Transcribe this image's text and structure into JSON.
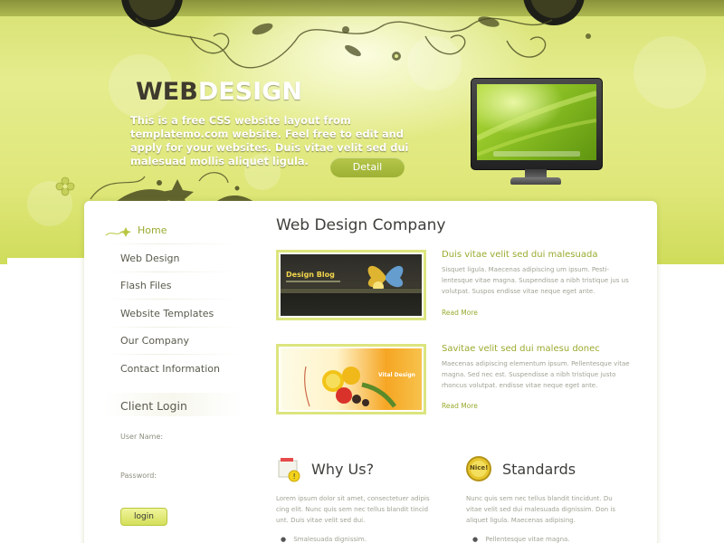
{
  "header": {
    "logo_web": "WEB",
    "logo_design": "DESIGN",
    "intro_text": "This is a free CSS website layout from templatemo.com website. Feel free to edit and apply for your websites. Duis vitae velit sed dui malesuad mollis aliquet ligula.",
    "detail_button": "Detail"
  },
  "sidebar": {
    "nav": [
      {
        "label": "Home",
        "active": true
      },
      {
        "label": "Web Design",
        "active": false
      },
      {
        "label": "Flash Files",
        "active": false
      },
      {
        "label": "Website Templates",
        "active": false
      },
      {
        "label": "Our Company",
        "active": false
      },
      {
        "label": "Contact Information",
        "active": false
      }
    ],
    "login": {
      "title": "Client Login",
      "username_label": "User Name:",
      "password_label": "Password:",
      "button": "login"
    }
  },
  "main": {
    "title": "Web Design Company",
    "articles": [
      {
        "thumb_caption": "Design Blog",
        "title": "Duis vitae velit sed dui malesuada",
        "text": "Sisquet ligula. Maecenas adipiscing um ipsum. Pesti- lentesque vitae magna. Suspendisse a nibh tristique jus us volutpat. Suspos endisse vitae neque eget ante.",
        "read_more": "Read More"
      },
      {
        "thumb_caption": "Vital Design",
        "title": "Savitae velit sed dui malesu donec",
        "text": "Maecenas adipiscing elementum ipsum. Pellentesque vitae magna. Sed nec est. Suspendisse a nibh tristique justo rhoncus volutpat. endisse vitae neque eget ante.",
        "read_more": "Read More"
      }
    ],
    "why_us": {
      "title": "Why Us?",
      "text": "Lorem ipsum dolor sit amet, consectetuer adipis cing elit. Nunc quis sem nec tellus blandit tincid unt. Duis vitae velit sed dui.",
      "bullet": "Smalesuada dignissim."
    },
    "standards": {
      "title": "Standards",
      "badge": "Nice!",
      "text": "Nunc quis sem nec tellus blandit tincidunt. Du vitae velit sed dui malesuada dignissim. Don is aliquet ligula. Maecenas adipising.",
      "bullet": "Pellentesque vitae magna."
    }
  },
  "colors": {
    "accent": "#9aab2f",
    "header_green": "#dfe77a",
    "text_dark": "#3e3e3a",
    "text_light": "#a2a296"
  }
}
